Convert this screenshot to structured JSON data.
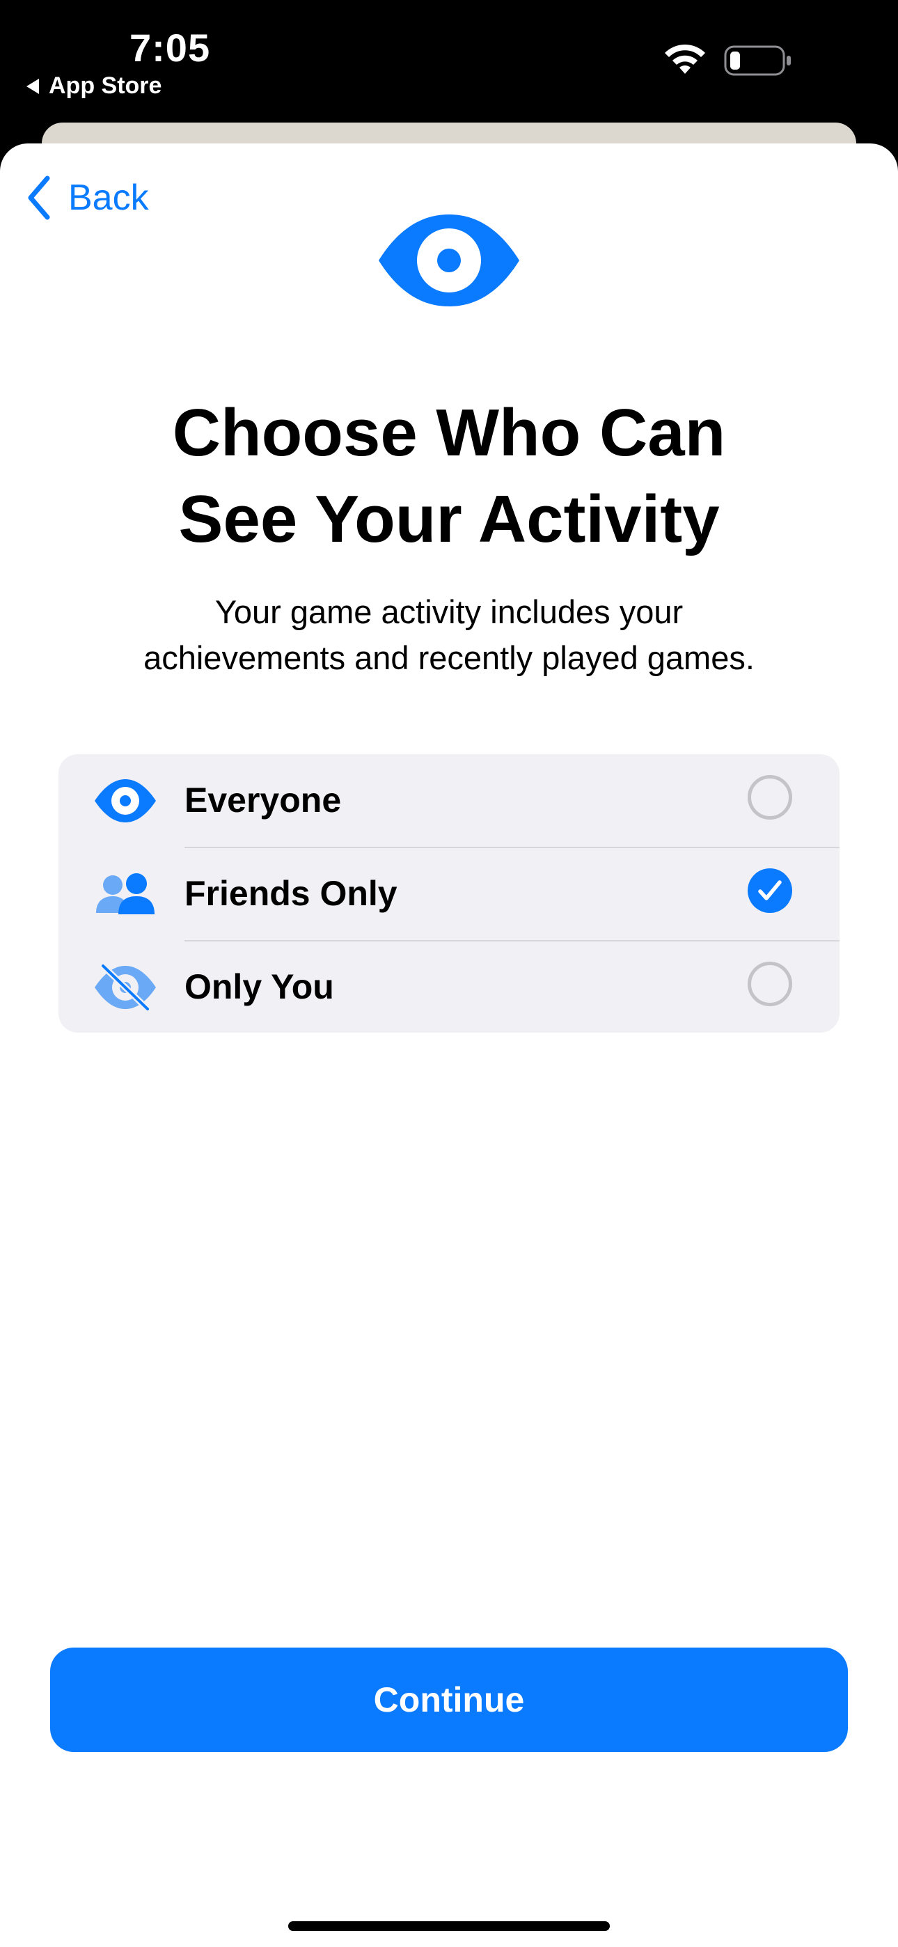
{
  "status_bar": {
    "time": "7:05",
    "back_app": "App Store",
    "wifi_icon": "wifi-icon",
    "battery_icon": "battery-low-icon"
  },
  "nav": {
    "back_label": "Back",
    "back_icon": "chevron-left-icon"
  },
  "hero": {
    "icon": "eye-icon",
    "title_line1": "Choose Who Can",
    "title_line2": "See Your Activity",
    "subtitle_line1": "Your game activity includes your",
    "subtitle_line2": "achievements and recently played games."
  },
  "options": [
    {
      "label": "Everyone",
      "icon": "eye-icon",
      "selected": false
    },
    {
      "label": "Friends Only",
      "icon": "people-icon",
      "selected": true
    },
    {
      "label": "Only You",
      "icon": "eye-slash-icon",
      "selected": false
    }
  ],
  "continue_label": "Continue",
  "colors": {
    "accent": "#0a7aff",
    "grouped_background": "#f0f0f5",
    "radio_border": "#c4c4c8"
  }
}
